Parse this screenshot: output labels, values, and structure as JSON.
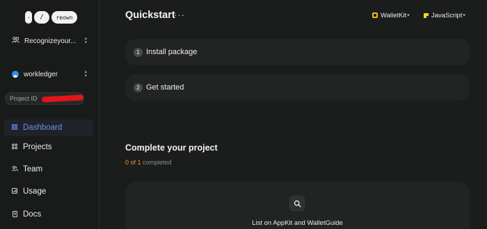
{
  "logo": {
    "mark1": "·",
    "mark2": "/",
    "brand": "reown"
  },
  "team_selector": {
    "label": "Recognizeyour..."
  },
  "project_selector": {
    "label": "workledger"
  },
  "project_id": {
    "label": "Project ID"
  },
  "nav": [
    {
      "label": "Dashboard",
      "icon": "grid-icon",
      "active": true
    },
    {
      "label": "Projects",
      "icon": "grid-icon"
    },
    {
      "label": "Team",
      "icon": "team-icon"
    },
    {
      "label": "Usage",
      "icon": "chart-icon"
    },
    {
      "label": "Docs",
      "icon": "doc-icon"
    }
  ],
  "header": {
    "title": "Quickstart",
    "more": "···"
  },
  "toolbar": {
    "sdk": "WalletKit",
    "language": "JavaScript"
  },
  "steps": [
    {
      "number": "1",
      "label": "Install package"
    },
    {
      "number": "2",
      "label": "Get started"
    }
  ],
  "complete": {
    "title": "Complete your project",
    "progress_done": "0 of 1",
    "progress_suffix": "completed"
  },
  "card": {
    "label": "List on AppKit and WalletGuide",
    "icon": "search-icon"
  },
  "colors": {
    "accent": "#6e8ff5",
    "progress": "#e79a37",
    "walletkit": "#f5c118"
  }
}
